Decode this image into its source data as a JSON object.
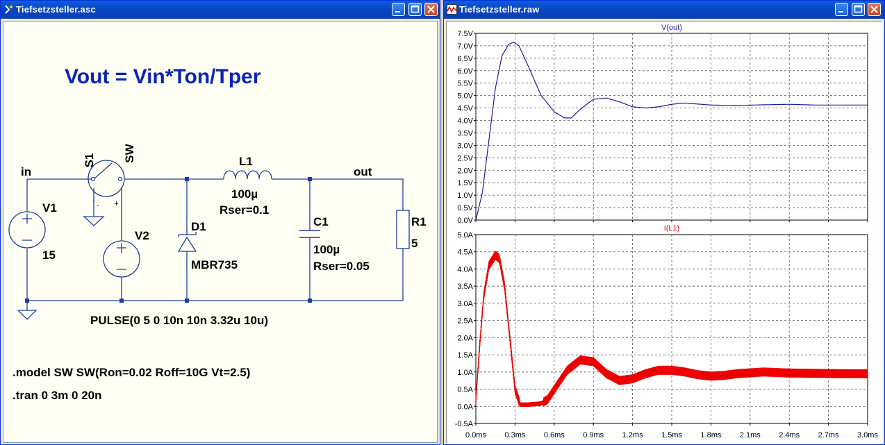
{
  "left_window": {
    "title": "Tiefsetzsteller.asc",
    "schematic": {
      "headline": "Vout = Vin*Ton/Tper",
      "net_in": "in",
      "net_out": "out",
      "s1_label": "S1",
      "s1_model": "SW",
      "s1_minus": "-",
      "s1_plus": "+",
      "v1_label": "V1",
      "v1_value": "15",
      "v2_label": "V2",
      "v2_value": "PULSE(0 5 0 10n 10n 3.32u 10u)",
      "l1_label": "L1",
      "l1_value": "100µ",
      "l1_rser": "Rser=0.1",
      "d1_label": "D1",
      "d1_model": "MBR735",
      "c1_label": "C1",
      "c1_value": "100µ",
      "c1_rser": "Rser=0.05",
      "r1_label": "R1",
      "r1_value": "5",
      "directive_model": ".model SW SW(Ron=0.02 Roff=10G Vt=2.5)",
      "directive_tran": ".tran 0 3m 0 20n"
    }
  },
  "right_window": {
    "title": "Tiefsetzsteller.raw"
  },
  "colors": {
    "titlebar": "#0a5fde",
    "schematic_bg": "#fffff4",
    "wire": "#1c3ca0",
    "headline": "#0a24b8",
    "vout_trace": "#1a1aa0",
    "il1_trace": "#ee0000",
    "plot_bg": "#ffffff"
  },
  "chart_data": [
    {
      "type": "line",
      "title": "V(out)",
      "x_unit": "ms",
      "y_unit": "V",
      "xlim": [
        0,
        3.0
      ],
      "ylim": [
        0,
        7.5
      ],
      "x_ticks": [
        "0.0ms",
        "0.3ms",
        "0.6ms",
        "0.9ms",
        "1.2ms",
        "1.5ms",
        "1.8ms",
        "2.1ms",
        "2.4ms",
        "2.7ms",
        "3.0ms"
      ],
      "y_ticks": [
        "0.0V",
        "0.5V",
        "1.0V",
        "1.5V",
        "2.0V",
        "2.5V",
        "3.0V",
        "3.5V",
        "4.0V",
        "4.5V",
        "5.0V",
        "5.5V",
        "6.0V",
        "6.5V",
        "7.0V",
        "7.5V"
      ],
      "grid": true,
      "series": [
        {
          "name": "V(out)",
          "x": [
            0,
            0.05,
            0.1,
            0.15,
            0.2,
            0.25,
            0.29,
            0.33,
            0.4,
            0.5,
            0.6,
            0.68,
            0.73,
            0.8,
            0.9,
            1.0,
            1.1,
            1.2,
            1.3,
            1.4,
            1.5,
            1.6,
            1.8,
            2.0,
            2.2,
            2.4,
            2.6,
            2.8,
            3.0
          ],
          "y": [
            0,
            1.1,
            3.2,
            5.3,
            6.6,
            7.05,
            7.15,
            7.0,
            6.2,
            5.0,
            4.35,
            4.1,
            4.1,
            4.45,
            4.85,
            4.9,
            4.75,
            4.55,
            4.5,
            4.55,
            4.65,
            4.7,
            4.62,
            4.6,
            4.63,
            4.65,
            4.62,
            4.62,
            4.62
          ]
        }
      ]
    },
    {
      "type": "line",
      "title": "I(L1)",
      "x_unit": "ms",
      "y_unit": "A",
      "xlim": [
        0,
        3.0
      ],
      "ylim": [
        -0.5,
        5.0
      ],
      "x_ticks": [
        "0.0ms",
        "0.3ms",
        "0.6ms",
        "0.9ms",
        "1.2ms",
        "1.5ms",
        "1.8ms",
        "2.1ms",
        "2.4ms",
        "2.7ms",
        "3.0ms"
      ],
      "y_ticks": [
        "-0.5A",
        "0.0A",
        "0.5A",
        "1.0A",
        "1.5A",
        "2.0A",
        "2.5A",
        "3.0A",
        "3.5A",
        "4.0A",
        "4.5A",
        "5.0A"
      ],
      "grid": true,
      "series": [
        {
          "name": "I(L1)",
          "x": [
            0,
            0.03,
            0.06,
            0.1,
            0.15,
            0.18,
            0.22,
            0.26,
            0.3,
            0.34,
            0.4,
            0.5,
            0.55,
            0.62,
            0.7,
            0.8,
            0.9,
            1.0,
            1.1,
            1.2,
            1.3,
            1.4,
            1.5,
            1.6,
            1.7,
            1.8,
            1.9,
            2.0,
            2.2,
            2.4,
            2.6,
            2.8,
            3.0
          ],
          "y": [
            0.2,
            1.8,
            3.2,
            4.1,
            4.4,
            4.3,
            3.5,
            2.0,
            0.5,
            0.05,
            0.05,
            0.08,
            0.2,
            0.6,
            1.05,
            1.35,
            1.3,
            0.95,
            0.75,
            0.8,
            0.95,
            1.05,
            1.05,
            1.0,
            0.92,
            0.88,
            0.9,
            0.95,
            1.0,
            0.97,
            0.96,
            0.95,
            0.95
          ],
          "ripple_amplitude": 0.13
        }
      ]
    }
  ]
}
